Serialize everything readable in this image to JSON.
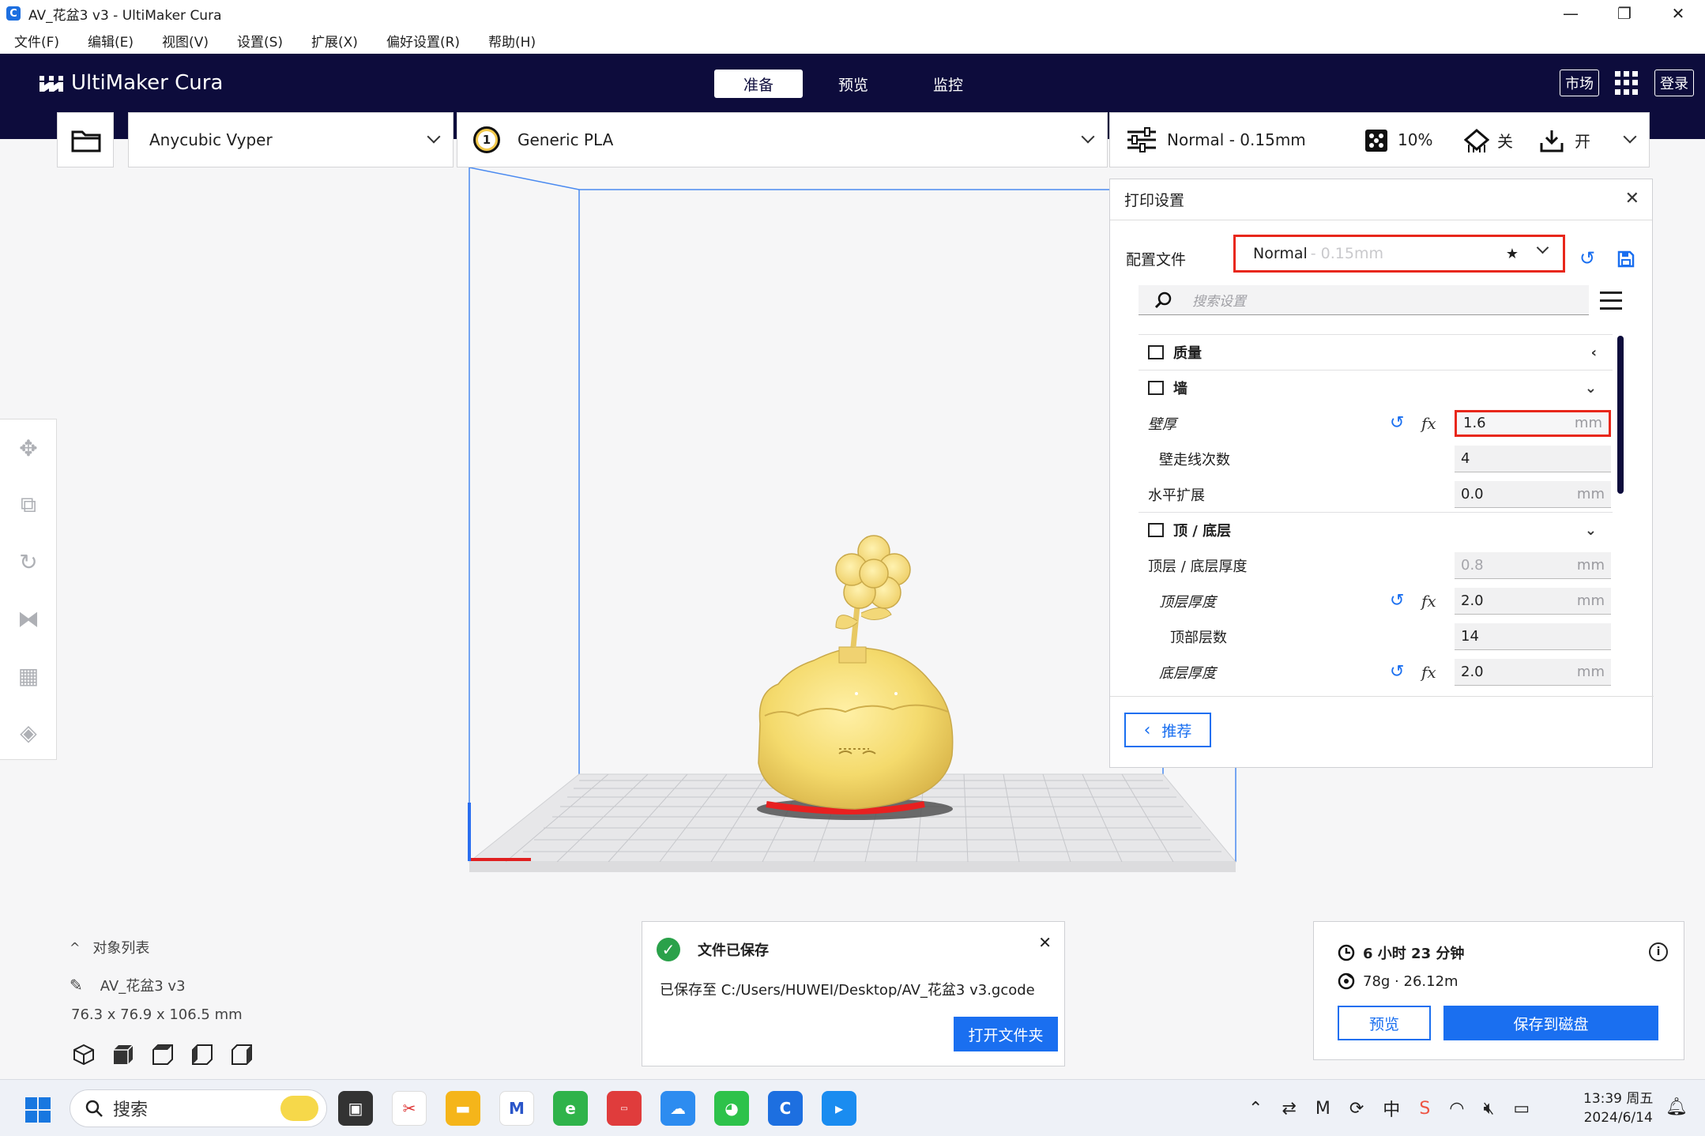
{
  "window": {
    "title": "AV_花盆3 v3 - UltiMaker Cura",
    "controls": [
      "—",
      "❐",
      "✕"
    ]
  },
  "menu": [
    "文件(F)",
    "编辑(E)",
    "视图(V)",
    "设置(S)",
    "扩展(X)",
    "偏好设置(R)",
    "帮助(H)"
  ],
  "header": {
    "brand": "UltiMaker Cura",
    "tabs": [
      "准备",
      "预览",
      "监控"
    ],
    "active_tab": "准备",
    "marketplace": "市场",
    "login": "登录"
  },
  "stage": {
    "printer": "Anycubic Vyper",
    "extruder_number": "1",
    "material": "Generic PLA",
    "profile_summary": "Normal - 0.15mm",
    "infill": "10%",
    "support": "关",
    "adhesion": "开"
  },
  "print_settings": {
    "title": "打印设置",
    "profile_label": "配置文件",
    "profile_name": "Normal",
    "profile_suffix": "- 0.15mm",
    "search_placeholder": "搜索设置",
    "rows": [
      {
        "type": "category",
        "label": "质量",
        "chevron": "‹"
      },
      {
        "type": "category",
        "label": "墙",
        "chevron": "⌄"
      },
      {
        "type": "setting",
        "label": "壁厚",
        "value": "1.6",
        "unit": "mm",
        "indent": 0,
        "italic": true,
        "reset": true,
        "highlight": true
      },
      {
        "type": "setting",
        "label": "壁走线次数",
        "value": "4",
        "unit": "",
        "indent": 1,
        "italic": false,
        "reset": false
      },
      {
        "type": "setting",
        "label": "水平扩展",
        "value": "0.0",
        "unit": "mm",
        "indent": 0,
        "italic": false,
        "reset": false
      },
      {
        "type": "category",
        "label": "顶 / 底层",
        "chevron": "⌄"
      },
      {
        "type": "setting",
        "label": "顶层 / 底层厚度",
        "value": "0.8",
        "unit": "mm",
        "indent": 0,
        "italic": false,
        "reset": false,
        "disabled": true
      },
      {
        "type": "setting",
        "label": "顶层厚度",
        "value": "2.0",
        "unit": "mm",
        "indent": 1,
        "italic": true,
        "reset": true
      },
      {
        "type": "setting",
        "label": "顶部层数",
        "value": "14",
        "unit": "",
        "indent": 2,
        "italic": false,
        "reset": false
      },
      {
        "type": "setting",
        "label": "底层厚度",
        "value": "2.0",
        "unit": "mm",
        "indent": 1,
        "italic": true,
        "reset": true
      }
    ],
    "recommended_button": "推荐"
  },
  "objects": {
    "header": "对象列表",
    "name": "AV_花盆3 v3",
    "dimensions": "76.3 x 76.9 x 106.5 mm"
  },
  "toast": {
    "title": "文件已保存",
    "message": "已保存至 C:/Users/HUWEI/Desktop/AV_花盆3 v3.gcode",
    "action": "打开文件夹"
  },
  "estimate": {
    "time": "6 小时 23 分钟",
    "material": "78g · 26.12m",
    "preview_button": "预览",
    "save_button": "保存到磁盘"
  },
  "taskbar": {
    "search": "搜索",
    "time": "13:39 周五",
    "date": "2024/6/14",
    "ime": "中"
  },
  "colors": {
    "header_bg": "#0d0c3c",
    "accent": "#1a6ff0",
    "highlight_box": "#e8271b",
    "model": "#f4dc74"
  }
}
